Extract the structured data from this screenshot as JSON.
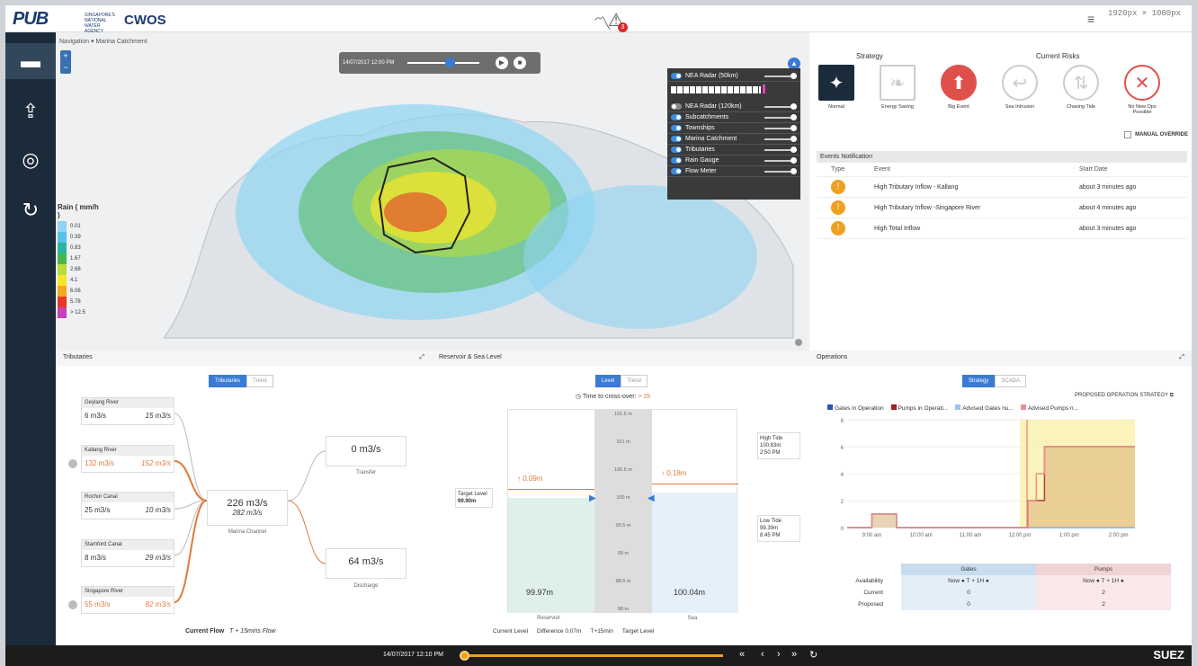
{
  "header": {
    "logo": "PUB",
    "logo_sub": "SINGAPORE'S NATIONAL WATER AGENCY",
    "app_name": "CWOS",
    "alert_count": "3",
    "resolution": "1920px × 1080px"
  },
  "map": {
    "breadcrumb_nav": "Navigation",
    "breadcrumb_page": "Marina Catchment",
    "zoom_in": "+",
    "zoom_out": "−",
    "playback_time": "14/07/2017 12:00 PM",
    "layers": [
      {
        "label": "NEA Radar (50km)",
        "on": true
      },
      {
        "label": "NEA Radar (120km)",
        "on": false
      },
      {
        "label": "Subcatchments",
        "on": true
      },
      {
        "label": "Townships",
        "on": true
      },
      {
        "label": "Marina Catchment",
        "on": true
      },
      {
        "label": "Tributaries",
        "on": true
      },
      {
        "label": "Rain Gauge",
        "on": true
      },
      {
        "label": "Flow Meter",
        "on": true
      }
    ],
    "legend_title": "Rain ( mm/h )",
    "legend": [
      {
        "label": "0.01",
        "color": "#8fd4f2"
      },
      {
        "label": "0.39",
        "color": "#55c3e8"
      },
      {
        "label": "0.83",
        "color": "#2db3a4"
      },
      {
        "label": "1.67",
        "color": "#47b84a"
      },
      {
        "label": "2.68",
        "color": "#b8dc3a"
      },
      {
        "label": "4.1",
        "color": "#f5e62a"
      },
      {
        "label": "6.06",
        "color": "#f5a623"
      },
      {
        "label": "5.78",
        "color": "#e53a2a"
      },
      {
        "label": "> 12.5",
        "color": "#c83fb8"
      }
    ]
  },
  "strategy": {
    "strategy_title": "Strategy",
    "risks_title": "Current Risks",
    "items": [
      {
        "label": "Normal",
        "icon": "puzzle-icon",
        "color": "#1b2b3b"
      },
      {
        "label": "Energy Saving",
        "icon": "leaf-icon",
        "color": "#cccccc"
      },
      {
        "label": "Big Event",
        "icon": "arrow-up-icon",
        "color": "#e0504a"
      },
      {
        "label": "Sea Intrusion",
        "icon": "wave-arrow-icon",
        "color": "#cccccc"
      },
      {
        "label": "Chasing Tide",
        "icon": "tide-icon",
        "color": "#cccccc"
      },
      {
        "label": "No New Ops Possible",
        "icon": "cross-icon",
        "color": "#e0504a"
      }
    ],
    "manual_override": "MANUAL OVERRIDE"
  },
  "events": {
    "title": "Events Notification",
    "col_type": "Type",
    "col_event": "Event",
    "col_start": "Start Date",
    "rows": [
      {
        "event": "High Tributary Inflow - Kallang",
        "start": "about 3 minutes ago"
      },
      {
        "event": "High Tributary Inflow -Singapore River",
        "start": "about 4 minutes ago"
      },
      {
        "event": "High Total Inflow",
        "start": "about 3 minutes ago"
      }
    ]
  },
  "tributaries": {
    "title": "Tributaries",
    "tab_1": "Tributaries",
    "tab_2": "Trend",
    "rivers": [
      {
        "name": "Geylang River",
        "current": "6 m3/s",
        "forecast": "15 m3/s",
        "alert": false
      },
      {
        "name": "Kallang River",
        "current": "132 m3/s",
        "forecast": "152 m3/s",
        "alert": true
      },
      {
        "name": "Rochor Canal",
        "current": "25 m3/s",
        "forecast": "10 m3/s",
        "alert": false
      },
      {
        "name": "Stamford Canal",
        "current": "8 m3/s",
        "forecast": "29 m3/s",
        "alert": false
      },
      {
        "name": "Singapore River",
        "current": "55 m3/s",
        "forecast": "82 m3/s",
        "alert": true
      }
    ],
    "channel_current": "226 m3/s",
    "channel_forecast": "282 m3/s",
    "channel_label": "Marina Channel",
    "transfer_value": "0 m3/s",
    "transfer_label": "Transfer",
    "discharge_value": "64 m3/s",
    "discharge_label": "Discharge",
    "footer_current": "Current Flow",
    "footer_forecast": "T + 15mins Flow"
  },
  "reservoir": {
    "title": "Reservoir & Sea Level",
    "tab_1": "Level",
    "tab_2": "Trend",
    "crossover_label": "Time to cross-over:",
    "crossover_value": "> 2h",
    "target_label": "Target Level",
    "target_value": "99.90m",
    "reservoir_delta": "0.09m",
    "sea_delta": "0.18m",
    "reservoir_level": "99.97m",
    "sea_level": "100.04m",
    "reservoir_label": "Reservoir",
    "sea_label": "Sea",
    "high_tide": "High Tide",
    "high_tide_level": "100.83m",
    "high_tide_time": "2:50 PM",
    "low_tide": "Low Tide",
    "low_tide_level": "99.39m",
    "low_tide_time": "8:45 PM",
    "scale": [
      "101.5 m",
      "101 m",
      "100.5 m",
      "100 m",
      "99.5 m",
      "99 m",
      "98.5 m",
      "98 m"
    ],
    "legend_current": "Current Level",
    "legend_difference": "Difference 0.07m",
    "legend_t15": "T+15min",
    "legend_target": "Target Level"
  },
  "operations": {
    "title": "Operations",
    "tab_1": "Strategy",
    "tab_2": "SCADA",
    "proposed_title": "PROPOSED OPERATION STRATEGY",
    "legend": [
      {
        "label": "Gates in Operation",
        "color": "#2a56b8"
      },
      {
        "label": "Pumps in Operati...",
        "color": "#a32020"
      },
      {
        "label": "Advised Gates nu...",
        "color": "#9ec3e6"
      },
      {
        "label": "Advised Pumps n...",
        "color": "#e89090"
      }
    ],
    "table_headers": [
      "",
      "Gates",
      "Pumps"
    ],
    "table_rows": [
      {
        "label": "Availability",
        "gates": "Now ● T + 1H ●",
        "pumps": "Now ● T + 1H ●"
      },
      {
        "label": "Current",
        "gates": "0",
        "pumps": "2"
      },
      {
        "label": "Proposed",
        "gates": "0",
        "pumps": "2"
      }
    ]
  },
  "chart_data": {
    "type": "line",
    "x": [
      "8:30 am",
      "9:00 am",
      "9:15 am",
      "9:30 am",
      "10:00 am",
      "11:00 am",
      "11:50 am",
      "12:00 pm",
      "12:10 pm",
      "12:20 pm",
      "12:30 pm",
      "1:00 pm",
      "2:00 pm",
      "2:20 pm"
    ],
    "series": [
      {
        "name": "Gates in Operation",
        "values": [
          0,
          1,
          1,
          0,
          0,
          0,
          0,
          0,
          0,
          0,
          0,
          0,
          0,
          0
        ]
      },
      {
        "name": "Pumps in Operati...",
        "values": [
          0,
          1,
          1,
          0,
          0,
          0,
          0,
          0,
          2,
          2,
          6,
          6,
          6,
          6
        ]
      },
      {
        "name": "Advised Gates nu...",
        "values": [
          0,
          1,
          1,
          0,
          0,
          0,
          0,
          0,
          0,
          0,
          0,
          0,
          0,
          0
        ]
      },
      {
        "name": "Advised Pumps n...",
        "values": [
          0,
          1,
          1,
          0,
          0,
          0,
          0,
          0,
          2,
          4,
          6,
          6,
          6,
          6
        ]
      }
    ],
    "x_ticks": [
      "9:00 am",
      "10:00 am",
      "11:00 am",
      "12:00 pm",
      "1:00 pm",
      "2:00 pm"
    ],
    "y_ticks": [
      "0",
      "2",
      "4",
      "6",
      "8"
    ],
    "ylim": [
      0,
      8
    ],
    "grid": true,
    "legend": "top"
  },
  "footer": {
    "timestamp": "14/07/2017 12:10 PM",
    "controls": [
      "«",
      "‹",
      "›",
      "»",
      "↻"
    ],
    "brand": "SUEZ"
  }
}
